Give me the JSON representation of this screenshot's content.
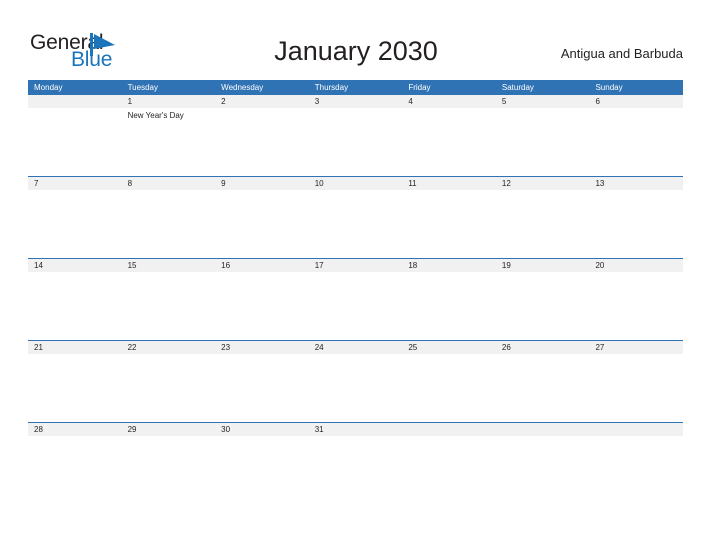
{
  "brand": {
    "word_one": "General",
    "word_two": "Blue",
    "flag_icon": "blue-flag-icon",
    "color_dark": "#231f20",
    "color_blue": "#1b75bb"
  },
  "header": {
    "title": "January 2030",
    "region": "Antigua and Barbuda"
  },
  "theme": {
    "header_blue": "#3073b4",
    "rule_blue": "#2e74b5",
    "band_gray": "#f1f1f1",
    "text_dark": "#231f20",
    "page_background": "#ffffff"
  },
  "calendar": {
    "month": "January",
    "year": "2030",
    "weekday_headers": [
      "Monday",
      "Tuesday",
      "Wednesday",
      "Thursday",
      "Friday",
      "Saturday",
      "Sunday"
    ],
    "weeks": [
      {
        "days": [
          {
            "number": "",
            "events": []
          },
          {
            "number": "1",
            "events": [
              "New Year's Day"
            ]
          },
          {
            "number": "2",
            "events": []
          },
          {
            "number": "3",
            "events": []
          },
          {
            "number": "4",
            "events": []
          },
          {
            "number": "5",
            "events": []
          },
          {
            "number": "6",
            "events": []
          }
        ]
      },
      {
        "days": [
          {
            "number": "7",
            "events": []
          },
          {
            "number": "8",
            "events": []
          },
          {
            "number": "9",
            "events": []
          },
          {
            "number": "10",
            "events": []
          },
          {
            "number": "11",
            "events": []
          },
          {
            "number": "12",
            "events": []
          },
          {
            "number": "13",
            "events": []
          }
        ]
      },
      {
        "days": [
          {
            "number": "14",
            "events": []
          },
          {
            "number": "15",
            "events": []
          },
          {
            "number": "16",
            "events": []
          },
          {
            "number": "17",
            "events": []
          },
          {
            "number": "18",
            "events": []
          },
          {
            "number": "19",
            "events": []
          },
          {
            "number": "20",
            "events": []
          }
        ]
      },
      {
        "days": [
          {
            "number": "21",
            "events": []
          },
          {
            "number": "22",
            "events": []
          },
          {
            "number": "23",
            "events": []
          },
          {
            "number": "24",
            "events": []
          },
          {
            "number": "25",
            "events": []
          },
          {
            "number": "26",
            "events": []
          },
          {
            "number": "27",
            "events": []
          }
        ]
      },
      {
        "days": [
          {
            "number": "28",
            "events": []
          },
          {
            "number": "29",
            "events": []
          },
          {
            "number": "30",
            "events": []
          },
          {
            "number": "31",
            "events": []
          },
          {
            "number": "",
            "events": []
          },
          {
            "number": "",
            "events": []
          },
          {
            "number": "",
            "events": []
          }
        ]
      }
    ]
  }
}
